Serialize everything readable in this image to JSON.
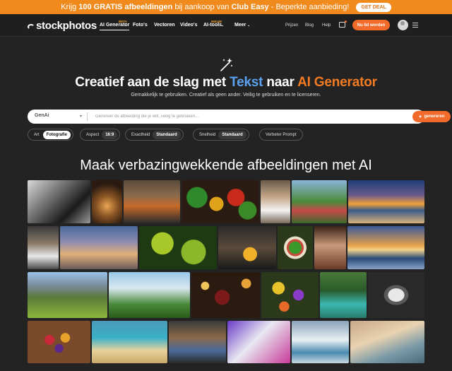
{
  "promo": {
    "text_a": "Krijg ",
    "text_b": "100 GRATIS afbeeldingen",
    "text_c": " bij aankoop van ",
    "text_d": "Club Easy",
    "text_e": " - Beperkte aanbieding!",
    "button": "GET DEAL"
  },
  "nav": {
    "logo": "stockphotos",
    "items": [
      "AI Generator",
      "Foto's",
      "Vectoren",
      "Video's",
      "AI-tools",
      "Meer"
    ],
    "tag_beta": "BETA",
    "tag_new": "NIEUW",
    "right": [
      "Prijzen",
      "Blog",
      "Help"
    ],
    "join": "Nu lid worden"
  },
  "hero": {
    "title_a": "Creatief aan de slag met ",
    "title_b": "Tekst",
    "title_c": " naar ",
    "title_d": "AI Generator",
    "subtitle": "Gemakkelijk te gebruiken. Creatief als geen ander. Veilig te gebruiken en te licenseren."
  },
  "search": {
    "engine": "GenAi",
    "placeholder": "Genereer de afbeelding die je wilt, veilig te gebruiken...",
    "button": "genereren"
  },
  "options": {
    "style_art": "Art",
    "style_photo": "Fotografie",
    "aspect_label": "Aspect",
    "aspect_value": "16:9",
    "accuracy_label": "Exactheid",
    "accuracy_value": "Standaard",
    "speed_label": "Snelheid",
    "speed_value": "Standaard",
    "improve": "Verbeter Prompt"
  },
  "gallery": {
    "title": "Maak verbazingwekkende afbeeldingen met AI",
    "images": [
      "man-smoking-bw",
      "whiskey-glass",
      "grill-skewers",
      "vegetables",
      "woman-cafe",
      "picnic-people",
      "sunset-beach",
      "chef-kitchen",
      "sky-clouds",
      "green-leaves",
      "beer-bar",
      "salad-bowl",
      "woman-portrait",
      "ocean-sunset",
      "mountain-valley",
      "man-grilling",
      "wine-glass",
      "flowers",
      "lake-forest",
      "bw-plate",
      "fruit-bowl",
      "beach-aerial",
      "man-barbecue",
      "woman-lab",
      "lab-scientist",
      "beach-coast"
    ]
  },
  "colors": {
    "accent": "#f26b2b",
    "promo": "#f08a1d",
    "blue": "#5aa2f0",
    "bg": "#232323"
  }
}
